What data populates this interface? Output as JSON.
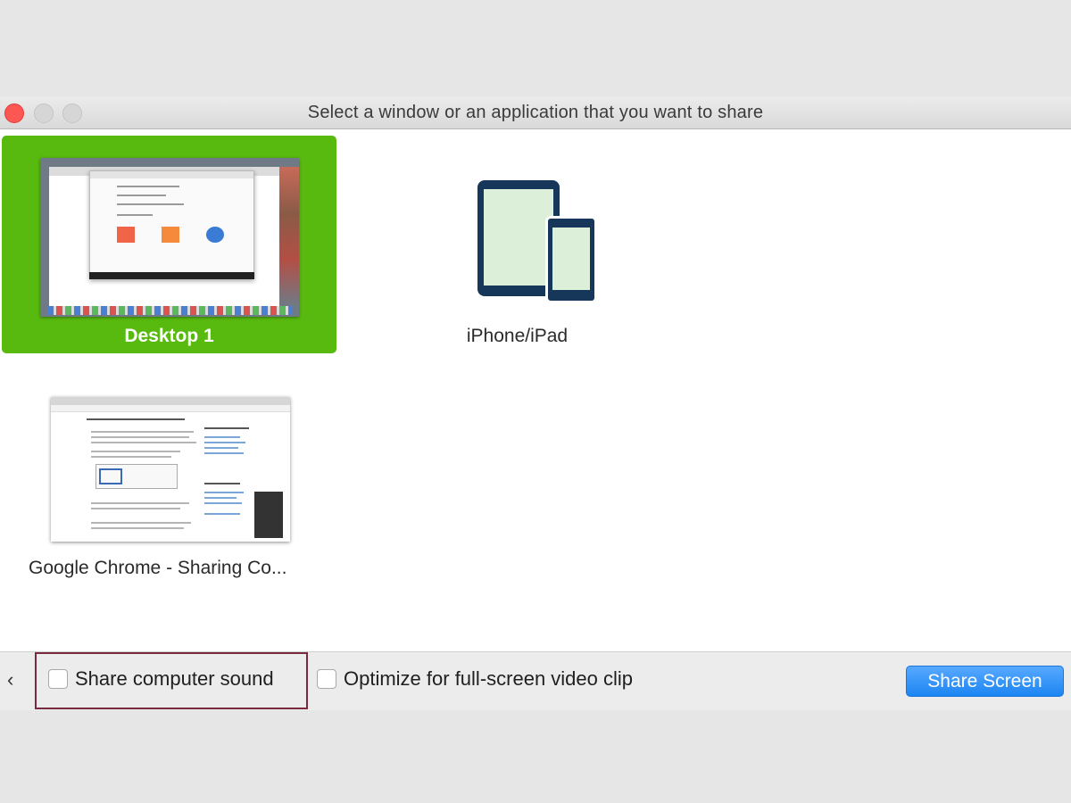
{
  "window": {
    "title": "Select a window or an application that you want to share"
  },
  "tiles": [
    {
      "label": "Desktop 1",
      "selected": true
    },
    {
      "label": "iPhone/iPad",
      "selected": false
    },
    {
      "label": "Google Chrome - Sharing Co...",
      "selected": false
    }
  ],
  "bottom": {
    "back_icon": "chevron-left-icon",
    "back_glyph": "‹",
    "share_sound_label": "Share computer sound",
    "share_sound_checked": false,
    "optimize_label": "Optimize for full-screen video clip",
    "optimize_checked": false,
    "share_button_label": "Share Screen"
  },
  "colors": {
    "selected_tile": "#58b90f",
    "share_button": "#1c85f2",
    "close_button": "#fc5753",
    "device_icon": "#17375a",
    "highlight_box": "#7a2a3e"
  }
}
